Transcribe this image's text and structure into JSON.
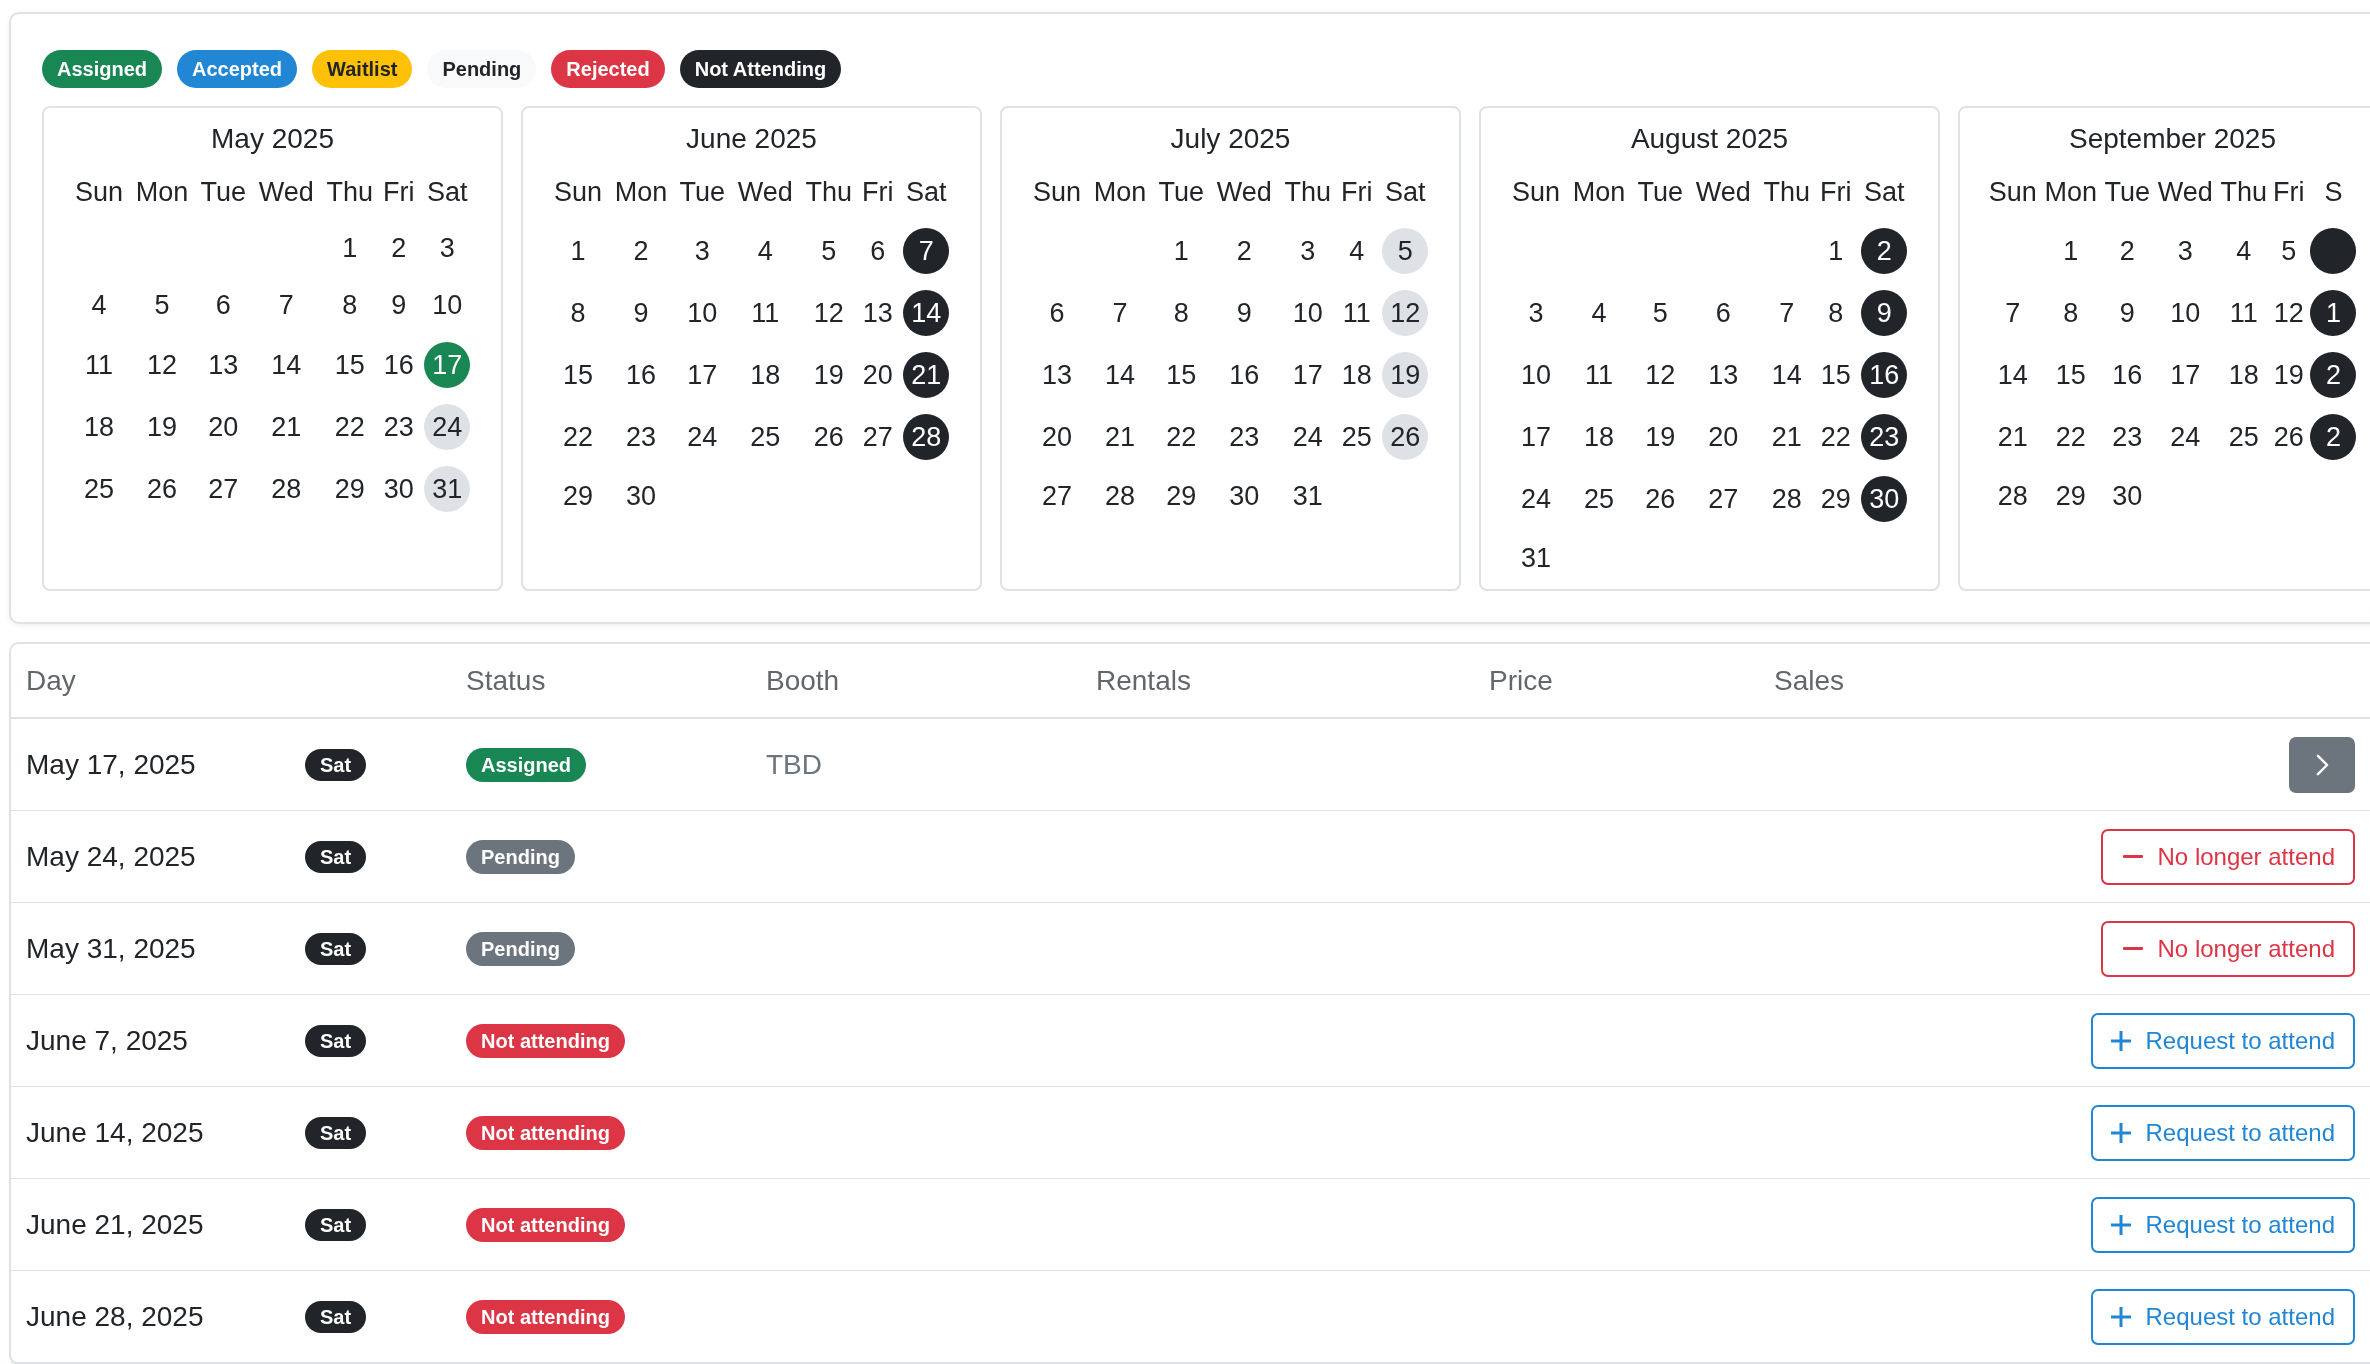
{
  "legend": [
    {
      "label": "Assigned",
      "color": "#198754"
    },
    {
      "label": "Accepted",
      "color": "#2186d4"
    },
    {
      "label": "Waitlist",
      "color": "#ffc107"
    },
    {
      "label": "Pending",
      "color": "#f8f9fa"
    },
    {
      "label": "Rejected",
      "color": "#dc3545"
    },
    {
      "label": "Not Attending",
      "color": "#212529"
    }
  ],
  "calendars": [
    {
      "title": "May 2025",
      "weekdays": [
        "Sun",
        "Mon",
        "Tue",
        "Wed",
        "Thu",
        "Fri",
        "Sat"
      ],
      "weeks": [
        [
          {
            "day": "1"
          },
          {
            "day": "2"
          },
          {
            "day": "3"
          }
        ],
        [
          {
            "day": "4"
          },
          {
            "day": "5"
          },
          {
            "day": "6"
          },
          {
            "day": "7"
          },
          {
            "day": "8"
          },
          {
            "day": "9"
          },
          {
            "day": "10"
          }
        ],
        [
          {
            "day": "11"
          },
          {
            "day": "12"
          },
          {
            "day": "13"
          },
          {
            "day": "14"
          },
          {
            "day": "15"
          },
          {
            "day": "16"
          },
          {
            "day": "17",
            "color": "#198754"
          }
        ],
        [
          {
            "day": "18"
          },
          {
            "day": "19"
          },
          {
            "day": "20"
          },
          {
            "day": "21"
          },
          {
            "day": "22"
          },
          {
            "day": "23"
          },
          {
            "day": "24",
            "color": "#dee2e6"
          }
        ],
        [
          {
            "day": "25"
          },
          {
            "day": "26"
          },
          {
            "day": "27"
          },
          {
            "day": "28"
          },
          {
            "day": "29"
          },
          {
            "day": "30"
          },
          {
            "day": "31",
            "color": "#dee2e6"
          }
        ]
      ]
    },
    {
      "title": "June 2025",
      "weekdays": [
        "Sun",
        "Mon",
        "Tue",
        "Wed",
        "Thu",
        "Fri",
        "Sat"
      ],
      "weeks": [
        [
          {
            "day": "1"
          },
          {
            "day": "2"
          },
          {
            "day": "3"
          },
          {
            "day": "4"
          },
          {
            "day": "5"
          },
          {
            "day": "6"
          },
          {
            "day": "7",
            "color": "#212529"
          }
        ],
        [
          {
            "day": "8"
          },
          {
            "day": "9"
          },
          {
            "day": "10"
          },
          {
            "day": "11"
          },
          {
            "day": "12"
          },
          {
            "day": "13"
          },
          {
            "day": "14",
            "color": "#212529"
          }
        ],
        [
          {
            "day": "15"
          },
          {
            "day": "16"
          },
          {
            "day": "17"
          },
          {
            "day": "18"
          },
          {
            "day": "19"
          },
          {
            "day": "20"
          },
          {
            "day": "21",
            "color": "#212529"
          }
        ],
        [
          {
            "day": "22"
          },
          {
            "day": "23"
          },
          {
            "day": "24"
          },
          {
            "day": "25"
          },
          {
            "day": "26"
          },
          {
            "day": "27"
          },
          {
            "day": "28",
            "color": "#212529"
          }
        ],
        [
          {
            "day": "29"
          },
          {
            "day": "30"
          }
        ]
      ]
    },
    {
      "title": "July 2025",
      "weekdays": [
        "Sun",
        "Mon",
        "Tue",
        "Wed",
        "Thu",
        "Fri",
        "Sat"
      ],
      "weeks": [
        [
          {
            "day": "1"
          },
          {
            "day": "2"
          },
          {
            "day": "3"
          },
          {
            "day": "4"
          },
          {
            "day": "5",
            "color": "#dee2e6"
          }
        ],
        [
          {
            "day": "6"
          },
          {
            "day": "7"
          },
          {
            "day": "8"
          },
          {
            "day": "9"
          },
          {
            "day": "10"
          },
          {
            "day": "11"
          },
          {
            "day": "12",
            "color": "#dee2e6"
          }
        ],
        [
          {
            "day": "13"
          },
          {
            "day": "14"
          },
          {
            "day": "15"
          },
          {
            "day": "16"
          },
          {
            "day": "17"
          },
          {
            "day": "18"
          },
          {
            "day": "19",
            "color": "#dee2e6"
          }
        ],
        [
          {
            "day": "20"
          },
          {
            "day": "21"
          },
          {
            "day": "22"
          },
          {
            "day": "23"
          },
          {
            "day": "24"
          },
          {
            "day": "25"
          },
          {
            "day": "26",
            "color": "#dee2e6"
          }
        ],
        [
          {
            "day": "27"
          },
          {
            "day": "28"
          },
          {
            "day": "29"
          },
          {
            "day": "30"
          },
          {
            "day": "31"
          }
        ]
      ]
    },
    {
      "title": "August 2025",
      "weekdays": [
        "Sun",
        "Mon",
        "Tue",
        "Wed",
        "Thu",
        "Fri",
        "Sat"
      ],
      "weeks": [
        [
          {
            "day": "1"
          },
          {
            "day": "2",
            "color": "#212529"
          }
        ],
        [
          {
            "day": "3"
          },
          {
            "day": "4"
          },
          {
            "day": "5"
          },
          {
            "day": "6"
          },
          {
            "day": "7"
          },
          {
            "day": "8"
          },
          {
            "day": "9",
            "color": "#212529"
          }
        ],
        [
          {
            "day": "10"
          },
          {
            "day": "11"
          },
          {
            "day": "12"
          },
          {
            "day": "13"
          },
          {
            "day": "14"
          },
          {
            "day": "15"
          },
          {
            "day": "16",
            "color": "#212529"
          }
        ],
        [
          {
            "day": "17"
          },
          {
            "day": "18"
          },
          {
            "day": "19"
          },
          {
            "day": "20"
          },
          {
            "day": "21"
          },
          {
            "day": "22"
          },
          {
            "day": "23",
            "color": "#212529"
          }
        ],
        [
          {
            "day": "24"
          },
          {
            "day": "25"
          },
          {
            "day": "26"
          },
          {
            "day": "27"
          },
          {
            "day": "28"
          },
          {
            "day": "29"
          },
          {
            "day": "30",
            "color": "#212529"
          }
        ],
        [
          {
            "day": "31"
          }
        ]
      ]
    },
    {
      "title": "September 2025",
      "weekdays": [
        "Sun",
        "Mon",
        "Tue",
        "Wed",
        "Thu",
        "Fri",
        "S"
      ],
      "weeks": [
        [
          {
            "day": "1"
          },
          {
            "day": "2"
          },
          {
            "day": "3"
          },
          {
            "day": "4"
          },
          {
            "day": "5"
          },
          {
            "color": "#212529"
          }
        ],
        [
          {
            "day": "7"
          },
          {
            "day": "8"
          },
          {
            "day": "9"
          },
          {
            "day": "10"
          },
          {
            "day": "11"
          },
          {
            "day": "12"
          },
          {
            "day": "1",
            "color": "#212529"
          }
        ],
        [
          {
            "day": "14"
          },
          {
            "day": "15"
          },
          {
            "day": "16"
          },
          {
            "day": "17"
          },
          {
            "day": "18"
          },
          {
            "day": "19"
          },
          {
            "day": "2",
            "color": "#212529"
          }
        ],
        [
          {
            "day": "21"
          },
          {
            "day": "22"
          },
          {
            "day": "23"
          },
          {
            "day": "24"
          },
          {
            "day": "25"
          },
          {
            "day": "26"
          },
          {
            "day": "2",
            "color": "#212529"
          }
        ],
        [
          {
            "day": "28"
          },
          {
            "day": "29"
          },
          {
            "day": "30"
          }
        ]
      ]
    }
  ],
  "table": {
    "columns": [
      "Day",
      "Status",
      "Booth",
      "Rentals",
      "Price",
      "Sales"
    ],
    "rows": [
      {
        "date": "May 17, 2025",
        "weekday": "Sat",
        "status": {
          "label": "Assigned",
          "color": "#198754"
        },
        "booth": "TBD",
        "action": {
          "kind": "open"
        }
      },
      {
        "date": "May 24, 2025",
        "weekday": "Sat",
        "status": {
          "label": "Pending",
          "color": "#6c757d"
        },
        "action": {
          "kind": "withdraw",
          "label": "No longer attend"
        }
      },
      {
        "date": "May 31, 2025",
        "weekday": "Sat",
        "status": {
          "label": "Pending",
          "color": "#6c757d"
        },
        "action": {
          "kind": "withdraw",
          "label": "No longer attend"
        }
      },
      {
        "date": "June 7, 2025",
        "weekday": "Sat",
        "status": {
          "label": "Not attending",
          "color": "#dc3545"
        },
        "action": {
          "kind": "request",
          "label": "Request to attend"
        }
      },
      {
        "date": "June 14, 2025",
        "weekday": "Sat",
        "status": {
          "label": "Not attending",
          "color": "#dc3545"
        },
        "action": {
          "kind": "request",
          "label": "Request to attend"
        }
      },
      {
        "date": "June 21, 2025",
        "weekday": "Sat",
        "status": {
          "label": "Not attending",
          "color": "#dc3545"
        },
        "action": {
          "kind": "request",
          "label": "Request to attend"
        }
      },
      {
        "date": "June 28, 2025",
        "weekday": "Sat",
        "status": {
          "label": "Not attending",
          "color": "#dc3545"
        },
        "action": {
          "kind": "request",
          "label": "Request to attend"
        }
      }
    ]
  }
}
